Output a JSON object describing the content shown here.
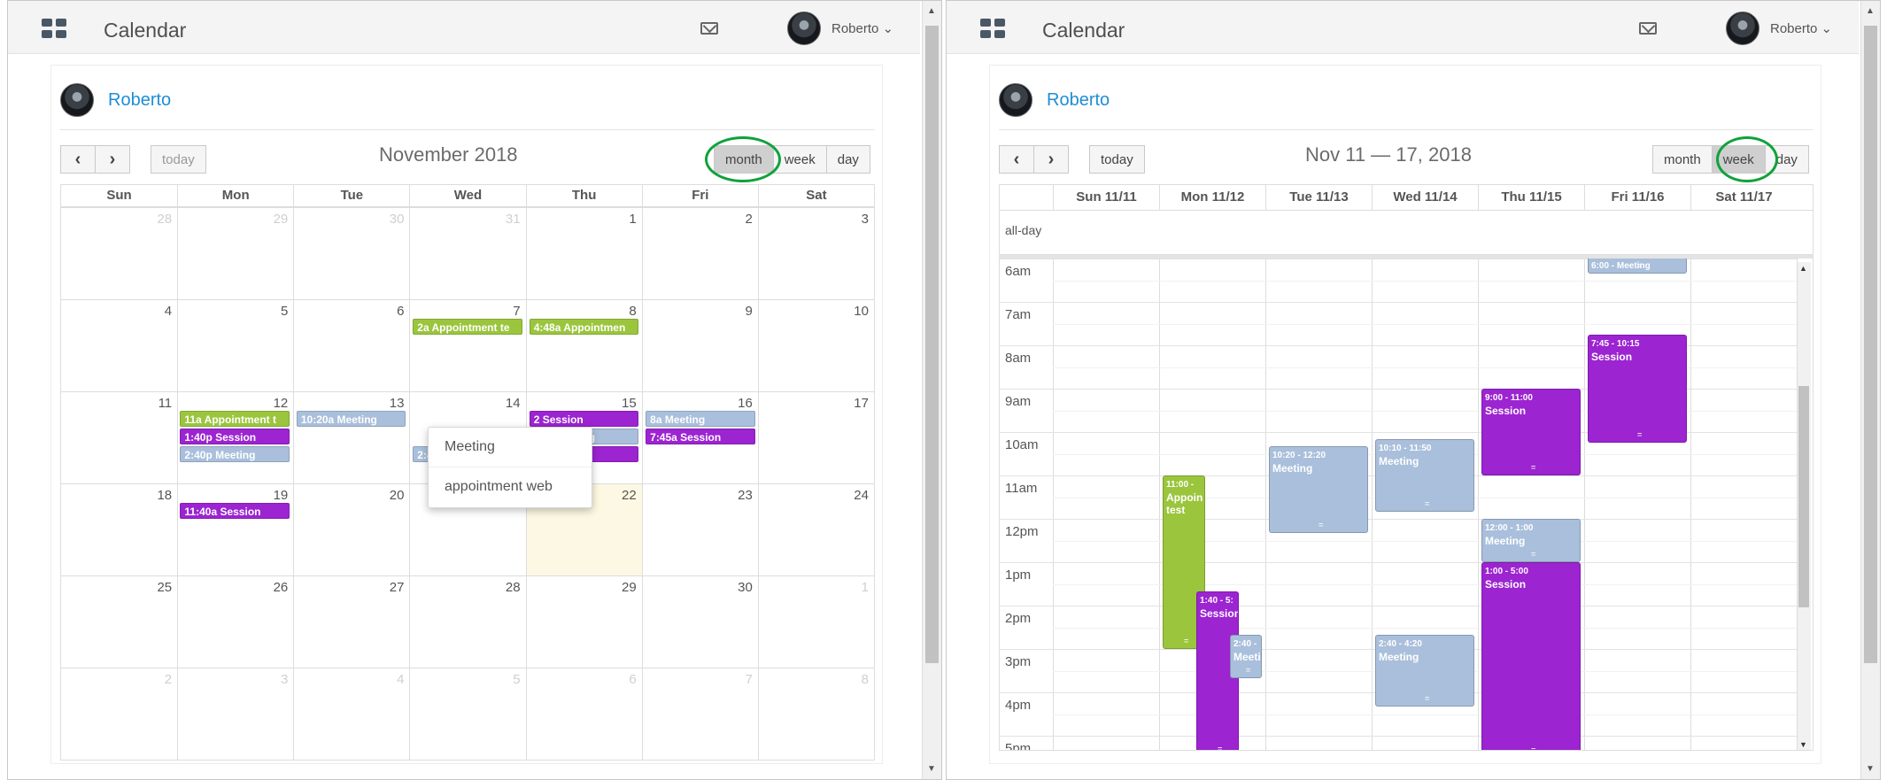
{
  "app": {
    "title": "Calendar",
    "user": "Roberto"
  },
  "month_view": {
    "owner": "Roberto",
    "title": "November 2018",
    "buttons": {
      "today": "today",
      "month": "month",
      "week": "week",
      "day": "day"
    },
    "dow": [
      "Sun",
      "Mon",
      "Tue",
      "Wed",
      "Thu",
      "Fri",
      "Sat"
    ],
    "weeks": [
      [
        "28",
        "29",
        "30",
        "31",
        "1",
        "2",
        "3"
      ],
      [
        "4",
        "5",
        "6",
        "7",
        "8",
        "9",
        "10"
      ],
      [
        "11",
        "12",
        "13",
        "14",
        "15",
        "16",
        "17"
      ],
      [
        "18",
        "19",
        "20",
        "21",
        "22",
        "23",
        "24"
      ],
      [
        "25",
        "26",
        "27",
        "28",
        "29",
        "30",
        "1"
      ],
      [
        "2",
        "3",
        "4",
        "5",
        "6",
        "7",
        "8"
      ]
    ],
    "events": {
      "w1_wed": "2a Appointment te",
      "w1_thu": "4:48a Appointmen",
      "w2_mon_1": "11a Appointment t",
      "w2_mon_2": "1:40p Session",
      "w2_mon_3": "2:40p Meeting",
      "w2_tue": "10:20a Meeting",
      "w2_wed_2": "2:40p Meeting",
      "w2_thu_1": "2 Session",
      "w2_thu_2": "12p Meeting",
      "w2_thu_3": "1p Session",
      "w2_fri_1": "8a Meeting",
      "w2_fri_2": "7:45a Session",
      "w3_mon": "11:40a Session"
    },
    "popup": [
      "Meeting",
      "appointment web"
    ]
  },
  "week_view": {
    "owner": "Roberto",
    "title": "Nov 11 — 17, 2018",
    "buttons": {
      "today": "today",
      "month": "month",
      "week": "week",
      "day": "day"
    },
    "days": [
      "Sun 11/11",
      "Mon 11/12",
      "Tue 11/13",
      "Wed 11/14",
      "Thu 11/15",
      "Fri 11/16",
      "Sat 11/17"
    ],
    "allday": "all-day",
    "hours": [
      "6am",
      "7am",
      "8am",
      "9am",
      "10am",
      "11am",
      "12pm",
      "1pm",
      "2pm",
      "3pm",
      "4pm",
      "5pm"
    ],
    "events": {
      "fri_meeting": {
        "time": "6:00 - Meeting",
        "name": ""
      },
      "fri_session": {
        "time": "7:45 - 10:15",
        "name": "Session"
      },
      "thu_session1": {
        "time": "9:00 - 11:00",
        "name": "Session"
      },
      "wed_meeting1": {
        "time": "10:10 - 11:50",
        "name": "Meeting"
      },
      "tue_meeting": {
        "time": "10:20 - 12:20",
        "name": "Meeting"
      },
      "mon_appt": {
        "time": "11:00 -",
        "name": "Appoin test"
      },
      "thu_meeting": {
        "time": "12:00 - 1:00",
        "name": "Meeting"
      },
      "thu_session2": {
        "time": "1:00 - 5:00",
        "name": "Session"
      },
      "mon_session": {
        "time": "1:40 - 5:",
        "name": "Session"
      },
      "mon_meeting": {
        "time": "2:40 -",
        "name": "Meeti"
      },
      "wed_meeting2": {
        "time": "2:40 - 4:20",
        "name": "Meeting"
      }
    }
  },
  "colors": {
    "appointment": "#9bc53d",
    "session": "#9c24d1",
    "meeting": "#a9bfdb",
    "today_bg": "#fcf8e3",
    "highlight_ring": "#10a23a",
    "link": "#1f8dd6"
  }
}
